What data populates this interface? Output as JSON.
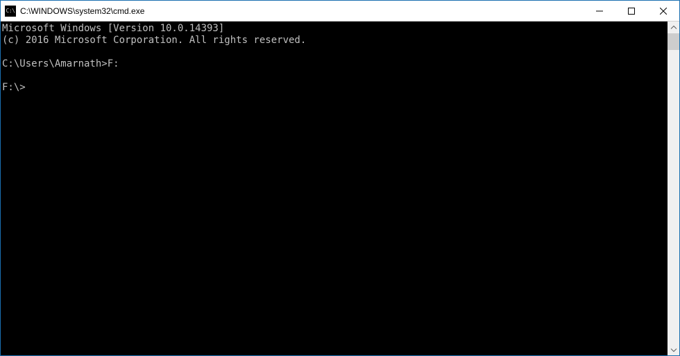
{
  "window": {
    "title": "C:\\WINDOWS\\system32\\cmd.exe",
    "icon_text": "C:\\"
  },
  "terminal": {
    "lines": [
      "Microsoft Windows [Version 10.0.14393]",
      "(c) 2016 Microsoft Corporation. All rights reserved.",
      "",
      "C:\\Users\\Amarnath>F:",
      "",
      "F:\\>"
    ]
  }
}
